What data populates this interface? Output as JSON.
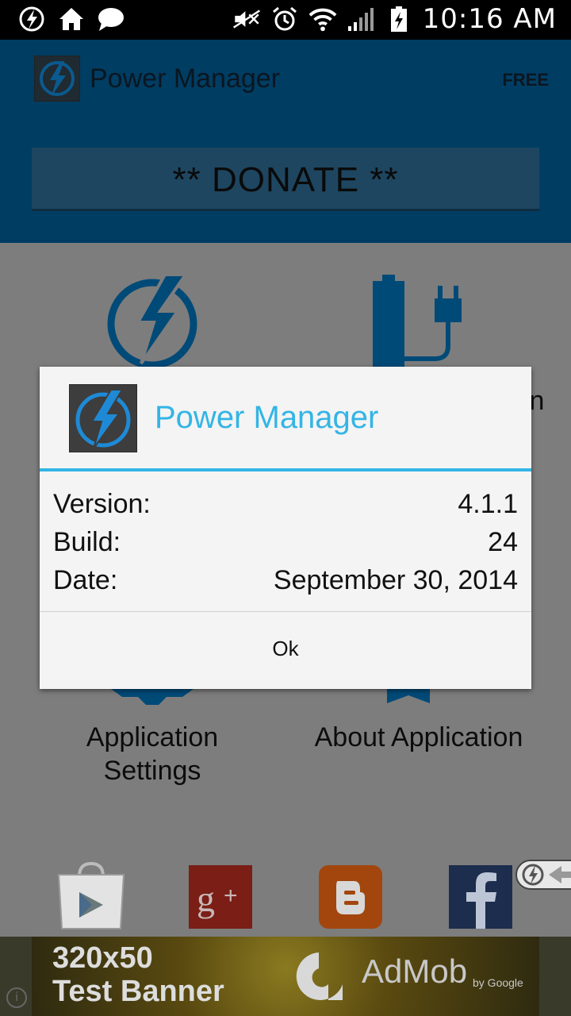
{
  "status_bar": {
    "time": "10:16 AM"
  },
  "header": {
    "title": "Power Manager",
    "badge": "FREE",
    "donate_label": "** DONATE **"
  },
  "grid": {
    "bottom_left_label_line1": "Application",
    "bottom_left_label_line2": "Settings",
    "bottom_right_label": "About Application",
    "top_right_partial": "n"
  },
  "dialog": {
    "title": "Power Manager",
    "rows": [
      {
        "key": "Version:",
        "value": "4.1.1"
      },
      {
        "key": "Build:",
        "value": "24"
      },
      {
        "key": "Date:",
        "value": "September 30, 2014"
      }
    ],
    "ok_label": "Ok"
  },
  "ad": {
    "line1": "320x50",
    "line2": "Test Banner",
    "brand": "AdMob",
    "by": "by Google",
    "info_icon": "i"
  },
  "colors": {
    "accent": "#33b5e5",
    "header_bg": "#003d63",
    "dim_bg": "#7d7d7d"
  },
  "icons": [
    "power-manager-icon",
    "home-icon",
    "chat-icon",
    "mute-icon",
    "alarm-icon",
    "wifi-icon",
    "signal-icon",
    "battery-charging-icon",
    "lightning-icon",
    "battery-plug-icon",
    "gear-icon",
    "ribbon-icon",
    "play-store-icon",
    "google-plus-icon",
    "blogger-icon",
    "facebook-icon"
  ]
}
